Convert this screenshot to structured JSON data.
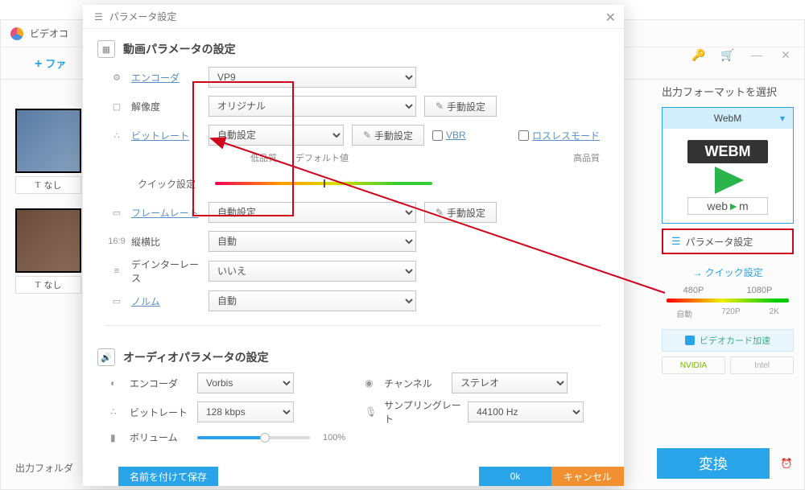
{
  "bg": {
    "app_title": "ビデオコ",
    "add_file": "ファ",
    "none": "なし",
    "output_folder": "出力フォルダ"
  },
  "sidebar": {
    "title": "出力フォーマットを選択",
    "format_name": "WebM",
    "webm_top": "WEBM",
    "webm_bot_a": "web",
    "webm_bot_b": "m",
    "param_settings": "パラメータ設定",
    "quick_settings": "クイック設定",
    "presets_top": [
      "480P",
      "1080P"
    ],
    "presets_bot": [
      "自動",
      "720P",
      "2K"
    ],
    "gpu_accel": "ビデオカード加速",
    "nvidia": "NVIDIA",
    "intel": "Intel",
    "convert": "変換"
  },
  "modal": {
    "title": "パラメータ設定",
    "video_section": "動画パラメータの設定",
    "audio_section": "オーディオパラメータの設定",
    "labels": {
      "encoder": "エンコーダ",
      "resolution": "解像度",
      "bitrate": "ビットレート",
      "quick_set": "クイック設定",
      "framerate": "フレームレート",
      "aspect": "縦横比",
      "deinterlace": "デインターレース",
      "norm": "ノルム",
      "channel": "チャンネル",
      "samplerate": "サンプリングレート",
      "volume": "ボリューム"
    },
    "values": {
      "encoder": "VP9",
      "resolution": "オリジナル",
      "bitrate": "自動設定",
      "framerate": "自動設定",
      "aspect": "自動",
      "deinterlace": "いいえ",
      "norm": "自動",
      "a_encoder": "Vorbis",
      "a_bitrate": "128 kbps",
      "channel": "ステレオ",
      "samplerate": "44100 Hz",
      "volume_pct": "100%"
    },
    "buttons": {
      "manual": "手動設定",
      "vbr": "VBR",
      "lossless": "ロスレスモード"
    },
    "quality": {
      "low": "低品質",
      "default": "デフォルト値",
      "high": "高品質"
    },
    "footer": {
      "save_as": "名前を付けて保存",
      "ok": "0k",
      "cancel": "キャンセル"
    }
  }
}
